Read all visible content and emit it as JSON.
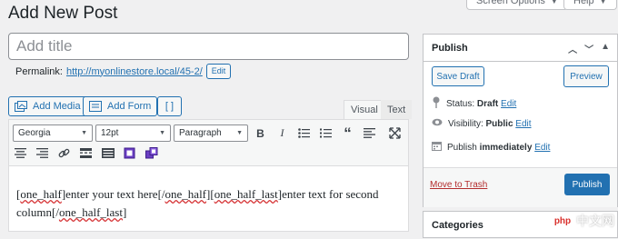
{
  "top_tabs": {
    "screen_options": "Screen Options",
    "help": "Help"
  },
  "page_title": "Add New Post",
  "title_input": {
    "placeholder": "Add title",
    "value": ""
  },
  "permalink": {
    "label": "Permalink:",
    "url": "http://myonlinestore.local/45-2/",
    "edit_label": "Edit"
  },
  "media_buttons": {
    "add_media": "Add Media",
    "add_form": "Add Form",
    "shortcode": "[ ]"
  },
  "editor_tabs": {
    "visual": "Visual",
    "text": "Text"
  },
  "toolbar": {
    "font_family": "Georgia",
    "font_size": "12pt",
    "format": "Paragraph",
    "row1_icons": [
      "bold-icon",
      "italic-icon",
      "bullet-list-icon",
      "numbered-list-icon",
      "blockquote-icon",
      "align-left-icon",
      "fullscreen-icon"
    ],
    "row2_icons": [
      "align-center-icon",
      "align-right-icon",
      "link-icon",
      "more-tag-icon",
      "toolbar-toggle-icon",
      "column-add-icon",
      "column-stack-icon"
    ]
  },
  "content": {
    "part1": "[",
    "sc1": "one_half",
    "part2": "]enter your text here[/",
    "sc2": "one_half",
    "part3": "][",
    "sc3": "one_half_last",
    "part4": "]enter text for second column[/",
    "sc4": "one_half_last",
    "part5": "]"
  },
  "publish_box": {
    "title": "Publish",
    "save_draft": "Save Draft",
    "preview": "Preview",
    "status_label": "Status:",
    "status_value": "Draft",
    "visibility_label": "Visibility:",
    "visibility_value": "Public",
    "publish_label": "Publish",
    "publish_value": "immediately",
    "edit_label": "Edit",
    "move_to_trash": "Move to Trash",
    "publish_button": "Publish"
  },
  "categories_box": {
    "title": "Categories"
  },
  "watermark": {
    "logo": "php",
    "text": "中文网"
  },
  "colors": {
    "accent": "#2271b1",
    "trash": "#b32d2e",
    "background": "#f0f0f1"
  }
}
